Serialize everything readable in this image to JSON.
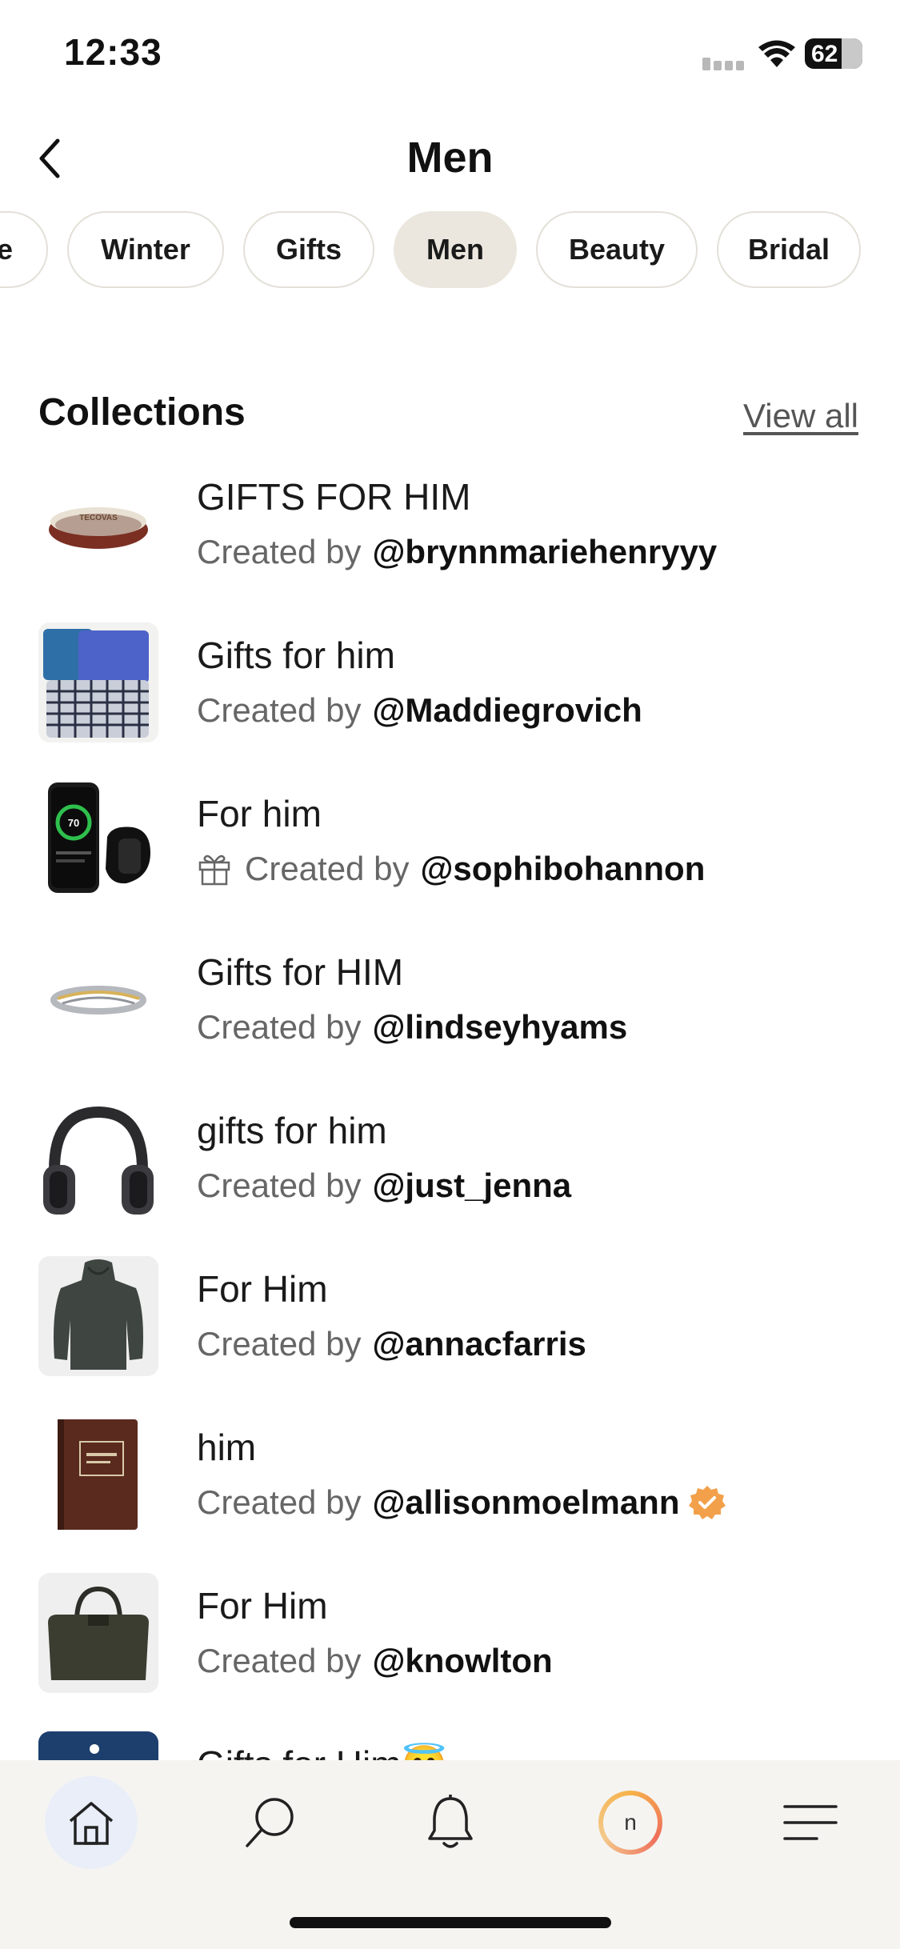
{
  "status_bar": {
    "time": "12:33",
    "battery": "62"
  },
  "header": {
    "title": "Men"
  },
  "chips": [
    {
      "label": "e"
    },
    {
      "label": "Winter"
    },
    {
      "label": "Gifts"
    },
    {
      "label": "Men",
      "active": true
    },
    {
      "label": "Beauty"
    },
    {
      "label": "Bridal"
    }
  ],
  "section": {
    "title": "Collections",
    "view_all": "View all"
  },
  "created_by_label": "Created by",
  "collections": [
    {
      "title": "GIFTS FOR HIM",
      "handle": "@brynnmariehenryyy",
      "thumb": "belt"
    },
    {
      "title": "Gifts for him",
      "handle": "@Maddiegrovich",
      "thumb": "boxers"
    },
    {
      "title": "For him",
      "handle": "@sophibohannon",
      "thumb": "phone-watch",
      "gift_icon": true
    },
    {
      "title": "Gifts for HIM",
      "handle": "@lindseyhyams",
      "thumb": "ring"
    },
    {
      "title": "gifts for him",
      "handle": "@just_jenna",
      "thumb": "headphones"
    },
    {
      "title": "For Him",
      "handle": "@annacfarris",
      "thumb": "hoodie"
    },
    {
      "title": "him",
      "handle": "@allisonmoelmann",
      "thumb": "book",
      "verified": true
    },
    {
      "title": "For Him",
      "handle": "@knowlton",
      "thumb": "duffel"
    },
    {
      "title": "Gifts for Him😇",
      "handle": "",
      "thumb": "night"
    }
  ],
  "tab_bar": {
    "items": [
      "home-icon",
      "search-icon",
      "bell-icon",
      "profile-avatar",
      "menu-icon"
    ],
    "avatar_initial": "n"
  },
  "colors": {
    "chip_active": "#ebe7de",
    "tab_active": "#e9eef9",
    "tab_bar_bg": "#f5f4f1"
  }
}
